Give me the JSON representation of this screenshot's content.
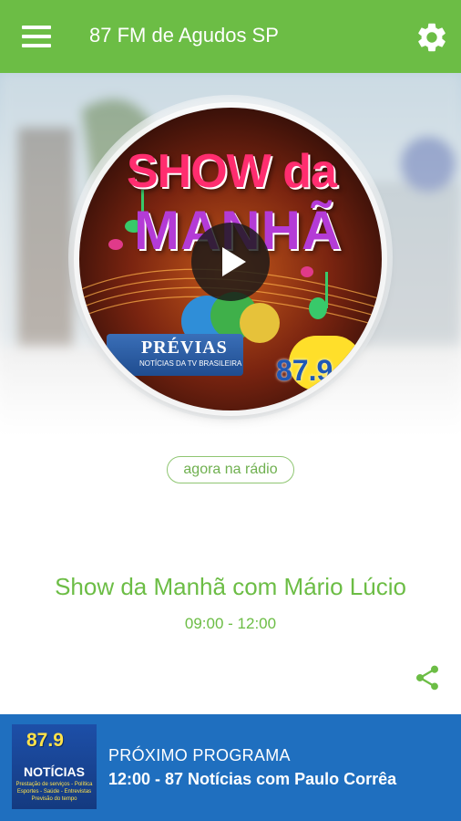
{
  "app": {
    "title": "87 FM de Agudos SP",
    "accent_color": "#6cbd45",
    "footer_color": "#1f6fbf"
  },
  "toolbar": {
    "menu_icon": "menu-icon",
    "settings_icon": "gear-icon"
  },
  "now_playing": {
    "cover": {
      "title_line1": "SHOW da",
      "title_line2": "MANHÃ",
      "badge": "PRÉVIAS",
      "badge_sub": "NOTÍCIAS DA TV BRASILEIRA",
      "frequency": "87.9"
    },
    "play_icon": "play-icon",
    "live_label": "agora na rádio",
    "show_name": "Show da Manhã com Mário Lúcio",
    "show_time": "09:00 - 12:00",
    "share_icon": "share-icon"
  },
  "next": {
    "label": "PRÓXIMO PROGRAMA",
    "program": "12:00 - 87 Notícias com Paulo Corrêa",
    "thumb": {
      "logo": "87.9",
      "title": "NOTÍCIAS",
      "subtitle": "Prestação de serviços - Política Esportes - Saúde - Entrevistas Previsão do tempo"
    }
  }
}
